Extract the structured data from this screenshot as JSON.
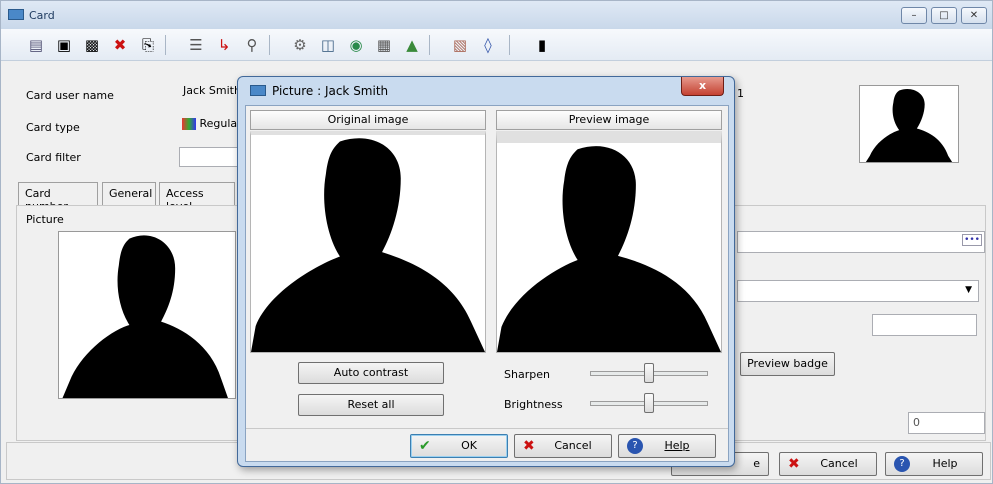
{
  "window": {
    "title": "Card"
  },
  "toolbar": {
    "icons": [
      "new-icon",
      "save-icon",
      "save-close-icon",
      "delete-icon",
      "print-icon",
      "list-icon",
      "link-icon",
      "search-icon",
      "keys-icon",
      "database-icon",
      "refresh-icon",
      "grid-icon",
      "export-icon",
      "import-icon",
      "settings-icon",
      "badge-icon"
    ]
  },
  "form": {
    "card_user_name_label": "Card user name",
    "card_user_name_value": "Jack Smith",
    "card_type_label": "Card type",
    "card_type_value": "Regular",
    "card_filter_label": "Card filter",
    "card_filter_value": "",
    "partial_label": "1"
  },
  "tabs": [
    {
      "label": "Card number"
    },
    {
      "label": "General"
    },
    {
      "label": "Access level"
    }
  ],
  "picture_section": {
    "label": "Picture"
  },
  "right_panel": {
    "preview_badge": "Preview badge",
    "number_value": "0",
    "field_dots": "•••"
  },
  "footer": {
    "cancel": "Cancel",
    "help": "Help",
    "save_fragment": "e"
  },
  "dialog": {
    "title": "Picture : Jack Smith",
    "original_header": "Original image",
    "preview_header": "Preview image",
    "auto_contrast": "Auto contrast",
    "reset_all": "Reset all",
    "sharpen_label": "Sharpen",
    "brightness_label": "Brightness",
    "sharpen_level": 0.5,
    "brightness_level": 0.5,
    "ok": "OK",
    "cancel": "Cancel",
    "help": "Help",
    "close_glyph": "x"
  },
  "colors": {
    "accent": "#4a88c8",
    "close_red": "#c44232",
    "check_green": "#2a9a2a",
    "cancel_red": "#cc1111"
  }
}
